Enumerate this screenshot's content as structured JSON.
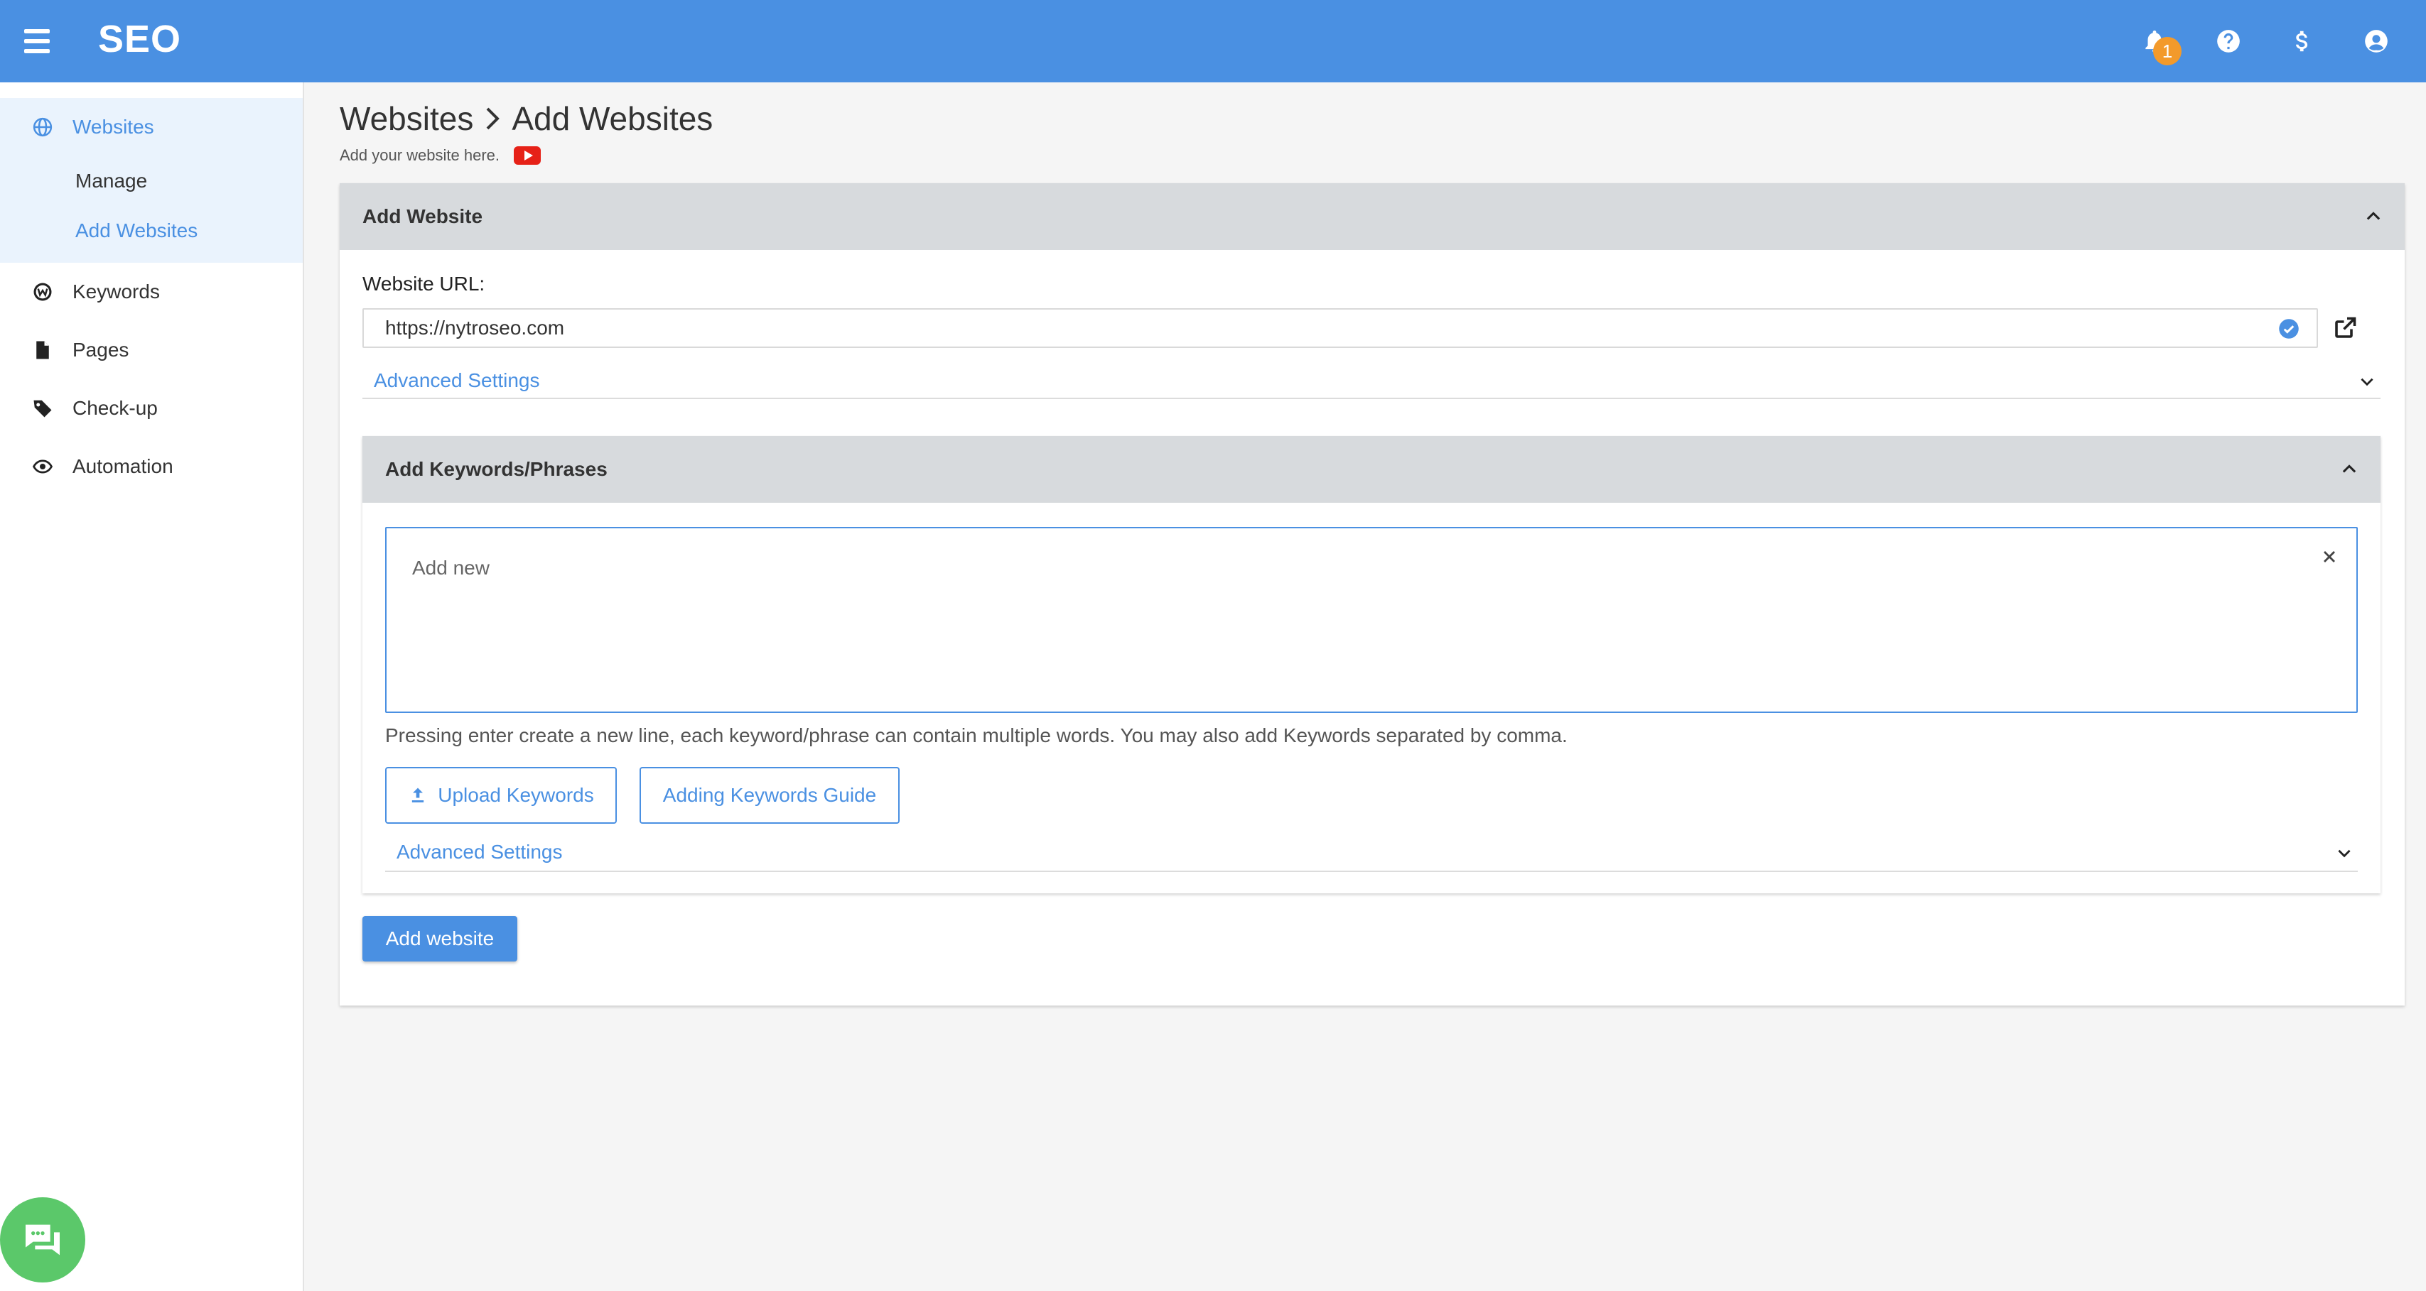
{
  "app": {
    "brand": "SEO"
  },
  "topbar": {
    "notification_count": "1",
    "icons": [
      "bell-icon",
      "help-icon",
      "dollar-icon",
      "account-icon"
    ]
  },
  "sidebar": {
    "items": [
      {
        "label": "Websites",
        "icon": "globe-icon",
        "active": true
      },
      {
        "label": "Keywords",
        "icon": "w-circle-icon"
      },
      {
        "label": "Pages",
        "icon": "file-icon"
      },
      {
        "label": "Check-up",
        "icon": "tag-icon"
      },
      {
        "label": "Automation",
        "icon": "eye-gear-icon"
      }
    ],
    "sub_items": [
      {
        "label": "Manage"
      },
      {
        "label": "Add Websites",
        "active": true
      }
    ]
  },
  "page": {
    "breadcrumb_root": "Websites",
    "breadcrumb_current": "Add Websites",
    "subtitle": "Add your website here."
  },
  "add_website": {
    "header": "Add Website",
    "url_label": "Website URL:",
    "url_value": "https://nytroseo.com",
    "advanced_label": "Advanced Settings"
  },
  "keywords": {
    "header": "Add Keywords/Phrases",
    "placeholder": "Add new",
    "help_text": "Pressing enter create a new line, each keyword/phrase can contain multiple words. You may also add Keywords separated by comma.",
    "upload_label": "Upload Keywords",
    "guide_label": "Adding Keywords Guide",
    "advanced_label": "Advanced Settings"
  },
  "actions": {
    "submit_label": "Add website"
  },
  "colors": {
    "primary": "#4a90e2",
    "badge": "#f39a2b",
    "chat": "#5bc86a",
    "header_gray": "#d7dadd"
  }
}
